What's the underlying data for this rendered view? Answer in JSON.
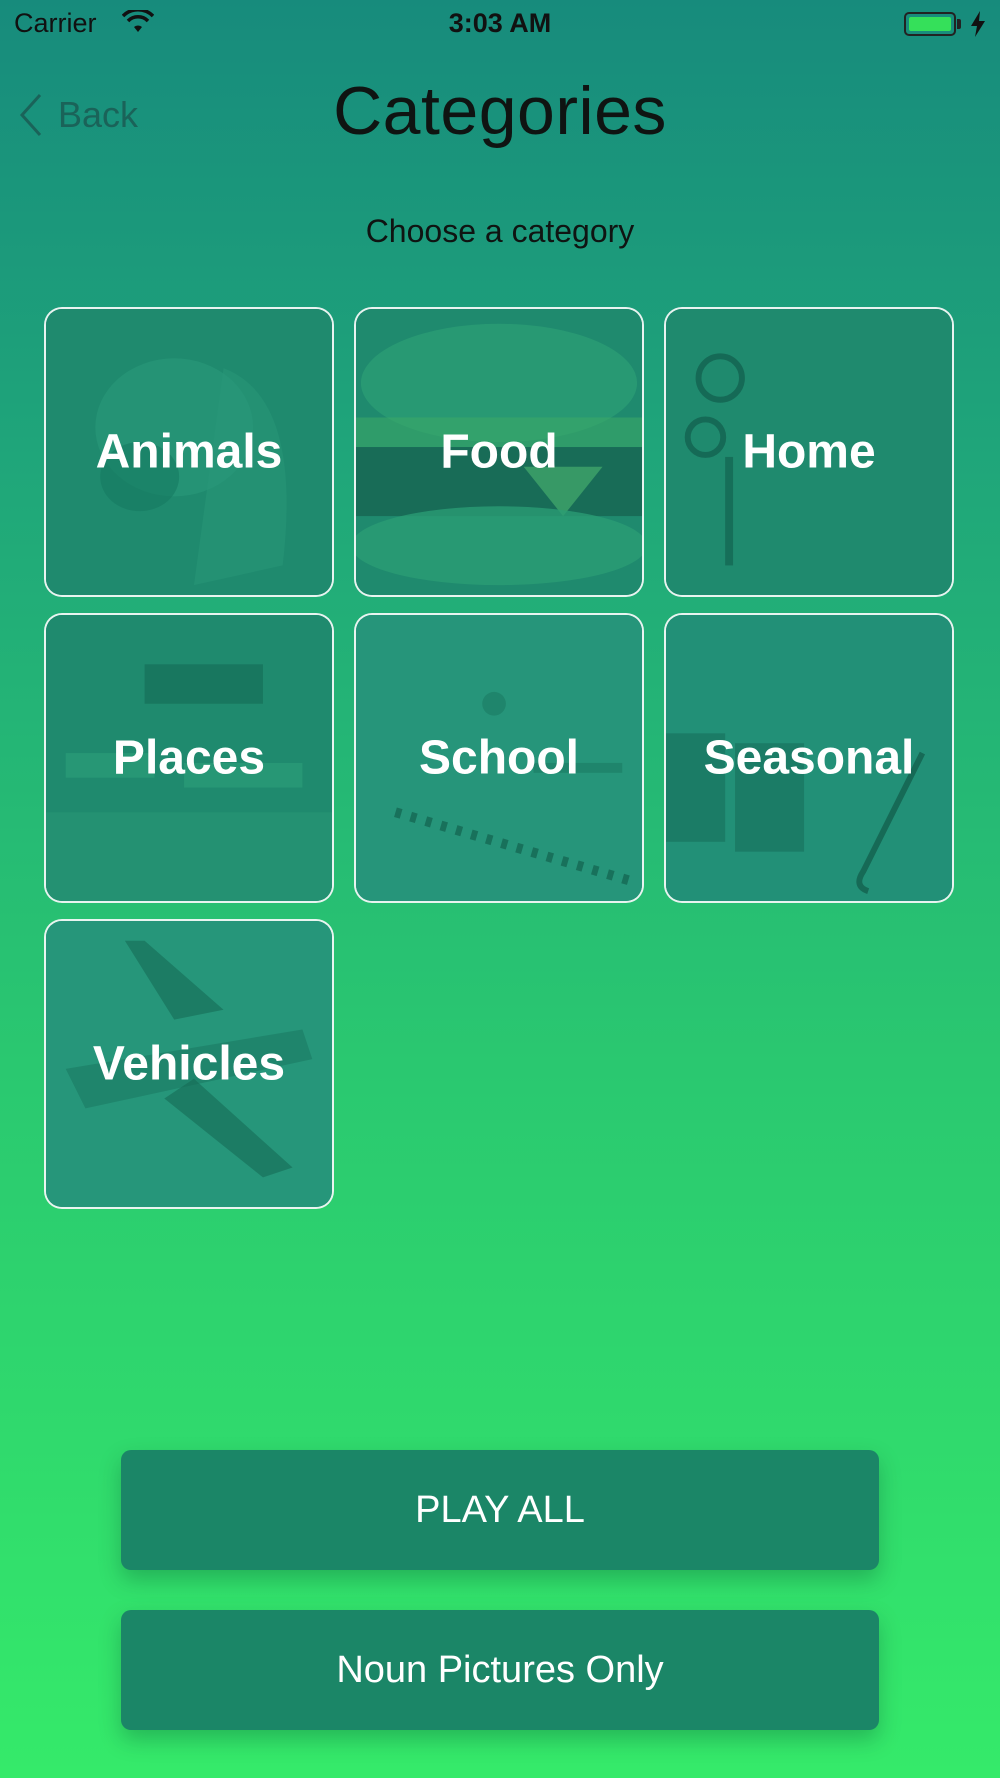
{
  "status_bar": {
    "carrier": "Carrier",
    "time": "3:03 AM"
  },
  "nav": {
    "back_label": "Back",
    "title": "Categories"
  },
  "subtitle": "Choose a category",
  "categories": [
    {
      "label": "Animals"
    },
    {
      "label": "Food"
    },
    {
      "label": "Home"
    },
    {
      "label": "Places"
    },
    {
      "label": "School"
    },
    {
      "label": "Seasonal"
    },
    {
      "label": "Vehicles"
    }
  ],
  "buttons": {
    "play_all": "PLAY ALL",
    "noun_pictures_only": "Noun Pictures Only"
  },
  "colors": {
    "button_bg": "#1b8667",
    "gradient_top": "#178b7c",
    "gradient_bottom": "#35ea6a",
    "tile_border": "#ffffff"
  }
}
